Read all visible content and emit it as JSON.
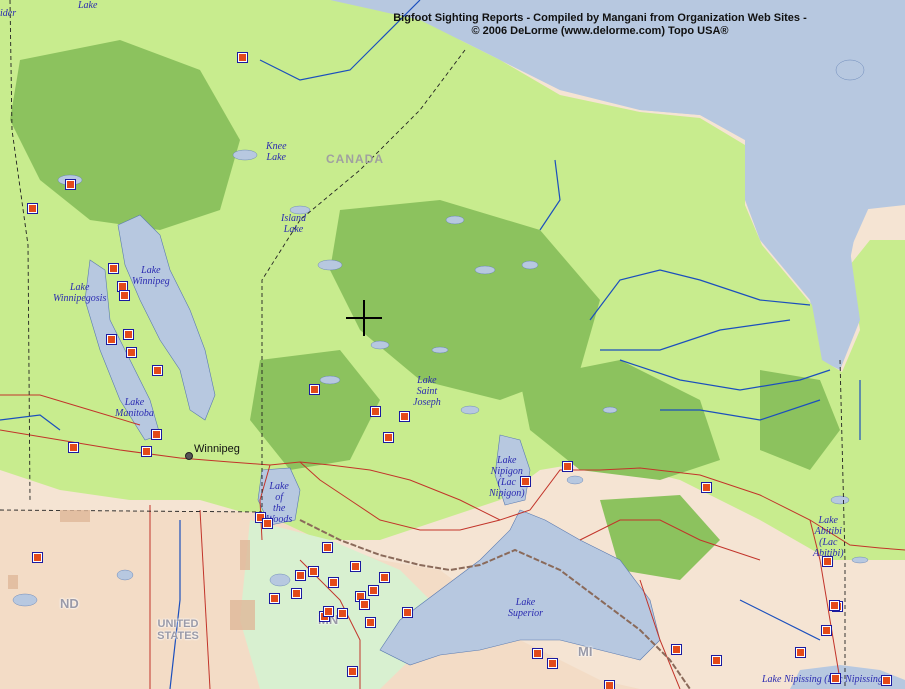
{
  "map": {
    "title_line1": "Bigfoot Sighting Reports - Compiled by Mangani from Organization Web Sites -",
    "title_line2": "© 2006 DeLorme (www.delorme.com) Topo USA®",
    "region_label": "CANADA",
    "country_label_1": "UNITED",
    "country_label_2": "STATES",
    "state_labels": [
      "ND",
      "MN",
      "MI"
    ],
    "city_label": "Winnipeg",
    "lake_labels": {
      "top": "Lake",
      "knee": "Knee\nLake",
      "island": "Island\nLake",
      "winnipeg": "Lake\nWinnipeg",
      "winnipegosis": "Lake\nWinnipegosis",
      "manitoba": "Lake\nManitoba",
      "saint_joseph": "Lake\nSaint\nJoseph",
      "nipigon": "Lake\nNipigon\n(Lac\nNipigon)",
      "woods": "Lake\nof\nthe\nWoods",
      "superior": "Lake\nSuperior",
      "abitibi": "Lake\nAbitibi\n(Lac\nAbitibi)",
      "nipissing": "Lake Nipissing (Lac Nipissing)",
      "cut_left": "ider"
    },
    "colors": {
      "water": "#b7c8e0",
      "land": "#f5e4d3",
      "forest_light": "#c8ec8e",
      "forest_dark": "#8cc25e",
      "river": "#1b4fbd",
      "road": "#c2342a",
      "marker": "#e34a1a",
      "marker_border": "#1a1aa0"
    },
    "sighting_markers_count": 52
  }
}
